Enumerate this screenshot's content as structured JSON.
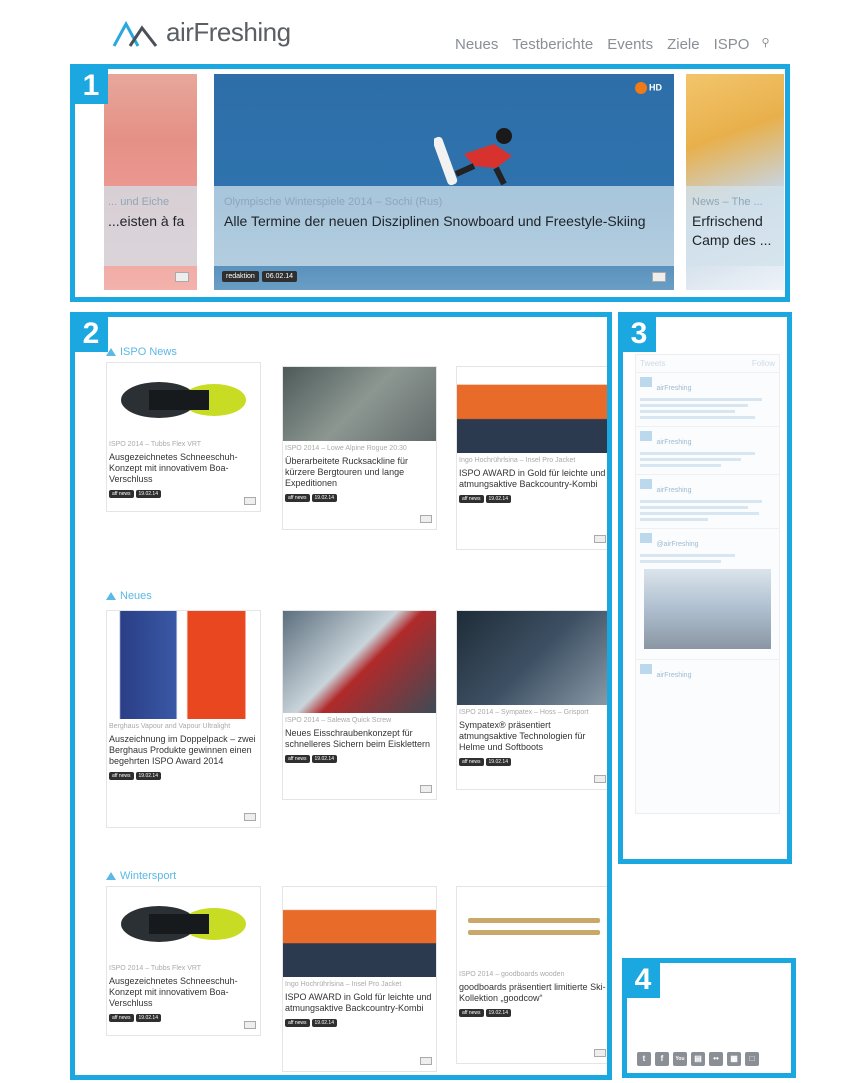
{
  "brand": {
    "name": "airFreshing"
  },
  "nav": {
    "items": [
      "Neues",
      "Testberichte",
      "Events",
      "Ziele",
      "ISPO"
    ]
  },
  "highlights": [
    "1",
    "2",
    "3",
    "4"
  ],
  "slider": {
    "left": {
      "meta": "... und Eiche",
      "title": "...eisten à fa"
    },
    "main": {
      "meta": "Olympische Winterspiele 2014 – Sochi (Rus)",
      "title": "Alle Termine der neuen Disziplinen Snowboard und Freestyle-Skiing",
      "author": "redaktion",
      "date": "06.02.14",
      "badge": "HD"
    },
    "right": {
      "meta": "News – The ...",
      "title": "Erfrischend Camp des ..."
    }
  },
  "sections": [
    {
      "label": "ISPO News"
    },
    {
      "label": "Neues"
    },
    {
      "label": "Wintersport"
    }
  ],
  "cards": [
    {
      "meta": "ISPO 2014 – Tubbs Flex VRT",
      "title": "Ausgezeichnetes Schneeschuh-Konzept mit innovativem Boa-Verschluss",
      "author": "aff news",
      "date": "19.02.14"
    },
    {
      "meta": "ISPO 2014 – Lowe Alpine Rogue 20:30",
      "title": "Überarbeitete Rucksackline für kürzere Bergtouren und lange Expeditionen",
      "author": "aff news",
      "date": "19.02.14"
    },
    {
      "meta": "Ingo Hochrührlsina – Insel Pro Jacket",
      "title": "ISPO AWARD in Gold für leichte und atmungsaktive Backcountry-Kombi",
      "author": "aff news",
      "date": "19.02.14"
    },
    {
      "meta": "Berghaus Vapour and Vapour Ultralight",
      "title": "Auszeichnung im Doppelpack – zwei Berghaus Produkte gewinnen einen begehrten ISPO Award 2014",
      "author": "aff news",
      "date": "19.02.14"
    },
    {
      "meta": "ISPO 2014 – Salewa Quick Screw",
      "title": "Neues Eisschraubenkonzept für schnelleres Sichern beim Eisklettern",
      "author": "aff news",
      "date": "19.02.14"
    },
    {
      "meta": "ISPO 2014 – Sympatex – Hoss – Grisport",
      "title": "Sympatex® präsentiert atmungsaktive Technologien für Helme und Softboots",
      "author": "aff news",
      "date": "19.02.14"
    },
    {
      "meta": "ISPO 2014 – Tubbs Flex VRT",
      "title": "Ausgezeichnetes Schneeschuh-Konzept mit innovativem Boa-Verschluss",
      "author": "aff news",
      "date": "19.02.14"
    },
    {
      "meta": "Ingo Hochrührlsina – Insel Pro Jacket",
      "title": "ISPO AWARD in Gold für leichte und atmungsaktive Backcountry-Kombi",
      "author": "aff news",
      "date": "19.02.14"
    },
    {
      "meta": "ISPO 2014 – goodboards wooden",
      "title": "goodboards präsentiert limitierte Ski-Kollektion „goodcow“",
      "author": "aff news",
      "date": "19.02.14"
    }
  ],
  "twitter": {
    "header": "Tweets",
    "follow": "Follow",
    "account": "airFreshing",
    "handle": "@airFreshing"
  },
  "social": [
    "t",
    "f",
    "You",
    "▤",
    "••",
    "▦",
    "□"
  ]
}
